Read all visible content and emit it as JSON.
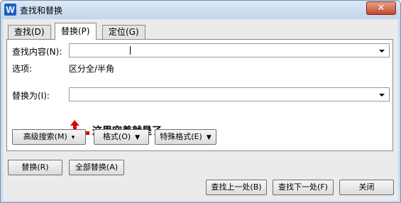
{
  "window": {
    "title": "查找和替换",
    "logo_letter": "W",
    "close_glyph": "✕"
  },
  "tabs": [
    {
      "label": "查找(D)"
    },
    {
      "label": "替换(P)"
    },
    {
      "label": "定位(G)"
    }
  ],
  "find": {
    "label": "查找内容(N):",
    "value": ""
  },
  "options": {
    "label": "选项:",
    "value": "区分全/半角"
  },
  "replace": {
    "label": "替换为(I):",
    "value": ""
  },
  "annotation": {
    "text": "这里空着就是了",
    "color": "#e00000"
  },
  "panel_buttons": {
    "advanced": "高级搜索(M)",
    "format": "格式(O)",
    "special": "特殊格式(E)"
  },
  "action_buttons": {
    "replace": "替换(R)",
    "replace_all": "全部替换(A)",
    "find_prev": "查找上一处(B)",
    "find_next": "查找下一处(F)",
    "close": "关闭"
  },
  "colors": {
    "accent": "#1f5fbf",
    "close_button": "#c4472c"
  }
}
